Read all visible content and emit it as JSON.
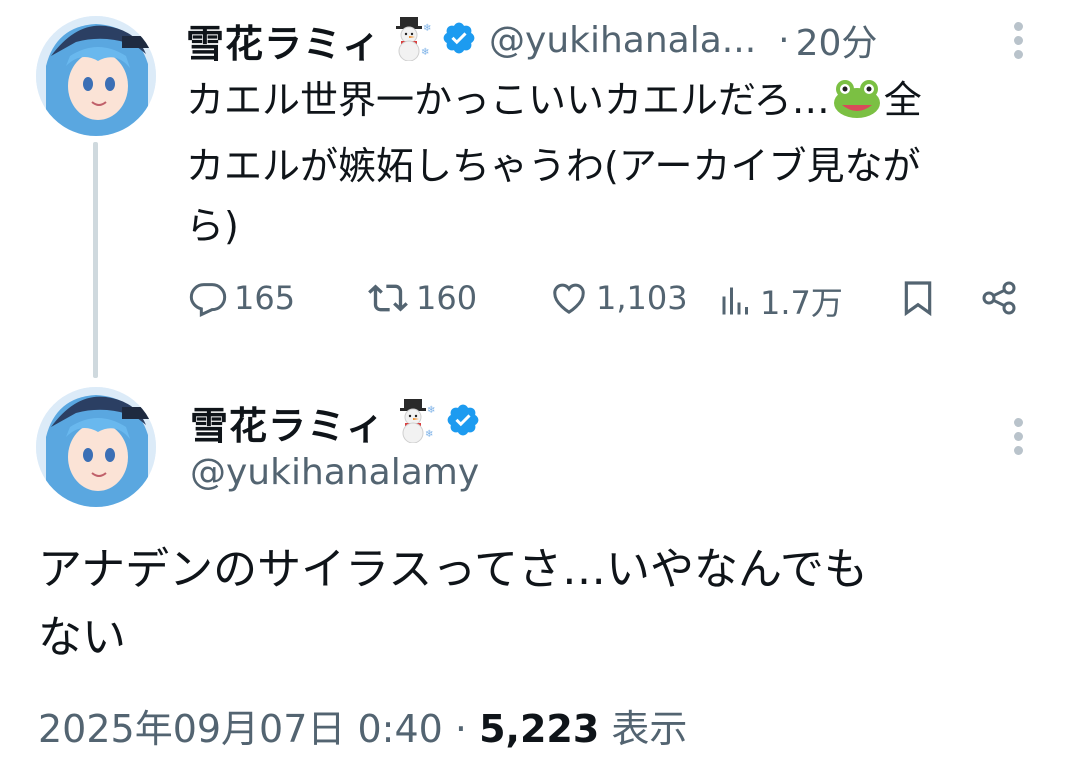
{
  "reply_tweet": {
    "display_name": "雪花ラミィ",
    "handle": "@yukihanala...",
    "separator": "·",
    "time_ago": "20分",
    "text_lines": [
      "カエル世界一かっこいいカエルだろ…",
      "全",
      "カエルが嫉妬しちゃうわ(アーカイブ見なが",
      "ら)"
    ],
    "actions": {
      "replies": "165",
      "retweets": "160",
      "likes": "1,103",
      "views": "1.7万"
    }
  },
  "main_tweet": {
    "display_name": "雪花ラミィ",
    "handle": "@yukihanalamy",
    "text_lines": [
      "アナデンのサイラスってさ…いやなんでも",
      "ない"
    ],
    "timestamp": "2025年09月07日 0:40",
    "separator": "·",
    "view_count": "5,223",
    "view_label": "表示"
  },
  "icons": {
    "verified": "verified-badge-icon",
    "snowman": "snowman-emoji",
    "frog": "frog-emoji",
    "reply": "reply-icon",
    "retweet": "retweet-icon",
    "like": "heart-icon",
    "views": "views-icon",
    "bookmark": "bookmark-icon",
    "share": "share-icon",
    "more": "more-vertical-icon"
  },
  "colors": {
    "text": "#0f1419",
    "secondary": "#536471",
    "verified": "#1d9bf0",
    "thread_line": "#cfd9de"
  }
}
